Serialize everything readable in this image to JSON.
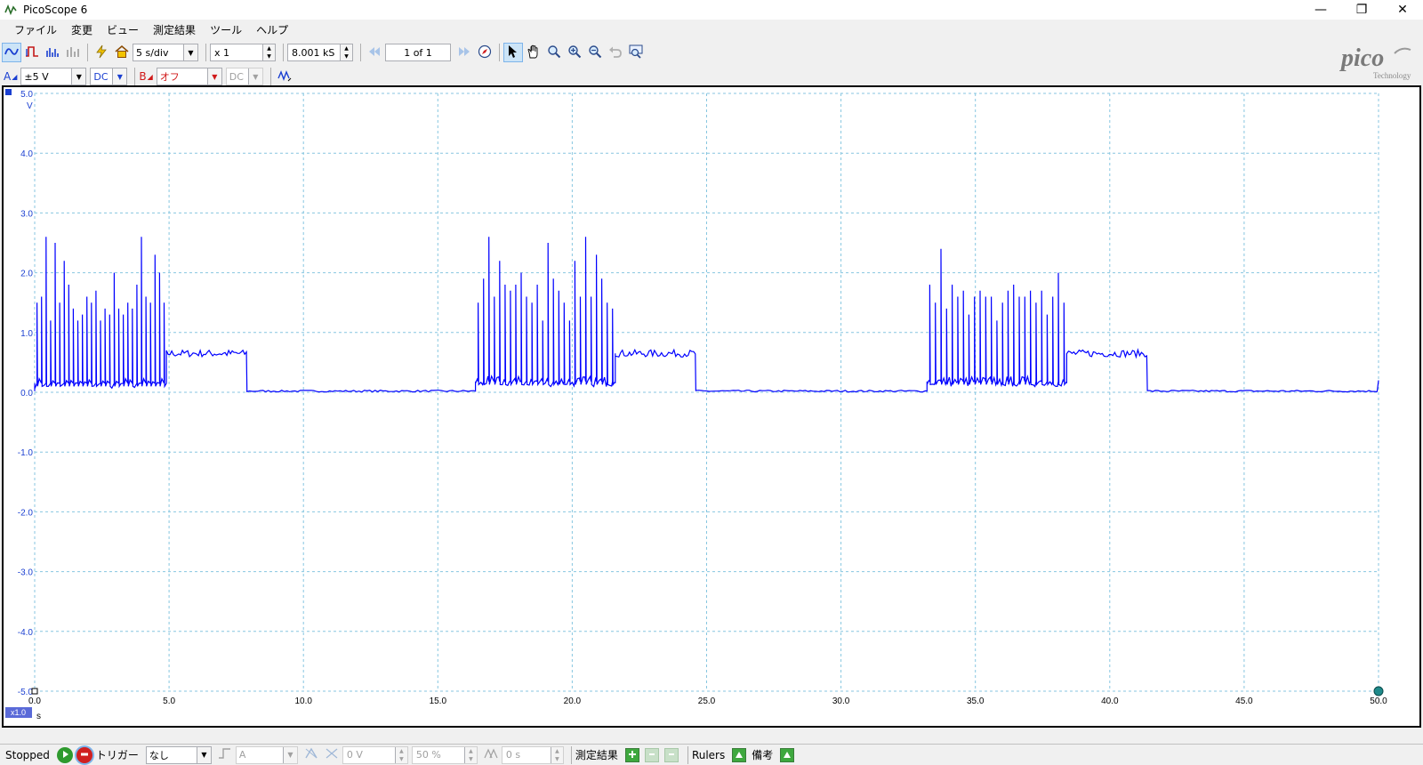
{
  "window": {
    "title": "PicoScope 6",
    "min": "—",
    "restore": "❐",
    "close": "✕"
  },
  "menu": [
    "ファイル",
    "変更",
    "ビュー",
    "測定結果",
    "ツール",
    "ヘルプ"
  ],
  "toolbar": {
    "timebase": "5 s/div",
    "zoom": "x 1",
    "samples": "8.001 kS",
    "buffer": "1 of 1"
  },
  "channels": {
    "a_label": "A",
    "a_range": "±5 V",
    "a_coupling": "DC",
    "b_label": "B",
    "b_range": "オフ",
    "b_coupling": "DC"
  },
  "logo": {
    "text": "pico",
    "sub": "Technology"
  },
  "scope": {
    "y_unit": "V",
    "x_unit": "s",
    "zoom_badge": "x1.0",
    "y_ticks": [
      "5.0",
      "4.0",
      "3.0",
      "2.0",
      "1.0",
      "0.0",
      "-1.0",
      "-2.0",
      "-3.0",
      "-4.0",
      "-5.0"
    ],
    "x_ticks": [
      "0.0",
      "5.0",
      "10.0",
      "15.0",
      "20.0",
      "25.0",
      "30.0",
      "35.0",
      "40.0",
      "45.0",
      "50.0"
    ],
    "trace_color": "#0000ff",
    "grid_color": "#87c6e0"
  },
  "chart_data": {
    "type": "line",
    "xlabel": "s",
    "ylabel": "V",
    "xlim": [
      0,
      50
    ],
    "ylim": [
      -5,
      5
    ],
    "series": [
      {
        "segments": [
          {
            "x0": 0.0,
            "x1": 4.9,
            "kind": "burst",
            "base": 0.15,
            "peaks": [
              1.5,
              1.6,
              2.6,
              1.2,
              2.5,
              1.5,
              2.2,
              1.8,
              1.4,
              1.2,
              1.3,
              1.6,
              1.5,
              1.7,
              1.2,
              1.4,
              1.3,
              2.0,
              1.4,
              1.3,
              1.5,
              1.4,
              1.8,
              2.6,
              1.6,
              1.5,
              2.3,
              2.0,
              1.5
            ]
          },
          {
            "x0": 4.9,
            "x1": 7.9,
            "kind": "step",
            "level": 0.65
          },
          {
            "x0": 7.9,
            "x1": 16.4,
            "kind": "flat",
            "level": 0.02
          },
          {
            "x0": 16.4,
            "x1": 21.6,
            "kind": "burst",
            "base": 0.18,
            "peaks": [
              1.5,
              1.9,
              2.6,
              1.6,
              2.2,
              1.8,
              1.7,
              1.8,
              2.0,
              1.6,
              1.5,
              1.8,
              1.2,
              2.5,
              1.9,
              1.7,
              1.5,
              1.2,
              2.2,
              1.6,
              2.6,
              1.6,
              2.3,
              1.9,
              1.5,
              1.4
            ]
          },
          {
            "x0": 21.6,
            "x1": 24.6,
            "kind": "step",
            "level": 0.65
          },
          {
            "x0": 24.6,
            "x1": 33.2,
            "kind": "flat",
            "level": 0.02
          },
          {
            "x0": 33.2,
            "x1": 38.4,
            "kind": "burst",
            "base": 0.18,
            "peaks": [
              1.8,
              1.5,
              2.4,
              1.4,
              1.8,
              1.6,
              1.7,
              1.3,
              1.6,
              1.7,
              1.6,
              1.6,
              1.2,
              1.5,
              1.7,
              1.8,
              1.6,
              1.6,
              1.7,
              1.5,
              1.7,
              1.3,
              1.6,
              2.0,
              1.5
            ]
          },
          {
            "x0": 38.4,
            "x1": 41.4,
            "kind": "step",
            "level": 0.65
          },
          {
            "x0": 41.4,
            "x1": 49.95,
            "kind": "flat",
            "level": 0.02
          },
          {
            "x0": 49.95,
            "x1": 50.0,
            "kind": "spike",
            "level": 0.2
          }
        ]
      }
    ]
  },
  "status": {
    "state": "Stopped",
    "trigger_label": "トリガー",
    "trigger_mode": "なし",
    "trigger_source": "A",
    "trigger_level": "0 V",
    "pretrigger": "50 %",
    "delay": "0 s",
    "measurements": "測定結果",
    "rulers": "Rulers",
    "notes": "備考"
  }
}
